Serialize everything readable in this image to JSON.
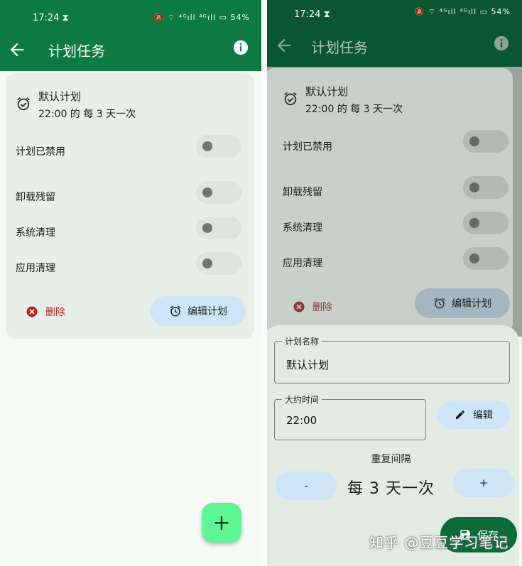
{
  "left": {
    "status": {
      "time": "17:24 ⧗",
      "icons": "🔕 ⌔ ⁴ᴳıll ⁴ᴳıll ▭ 54%",
      "battery": "54%"
    },
    "appbar": {
      "title": "计划任务"
    },
    "card": {
      "plan_name": "默认计划",
      "schedule": "22:00 的 每 3 天一次",
      "rows": [
        {
          "label": "计划已禁用",
          "enabled": false
        },
        {
          "label": "卸载残留",
          "enabled": false
        },
        {
          "label": "系统清理",
          "enabled": false
        },
        {
          "label": "应用清理",
          "enabled": false
        }
      ],
      "delete_label": "删除",
      "edit_plan_label": "编辑计划"
    },
    "fab_label": "+"
  },
  "right": {
    "status": {
      "time": "17:24 ⧗",
      "icons": "🔕 ⌔ ⁴ᴳıll ⁴ᴳıll ▭ 54%"
    },
    "appbar": {
      "title": "计划任务"
    },
    "card": {
      "plan_name": "默认计划",
      "schedule": "22:00 的 每 3 天一次",
      "rows": [
        {
          "label": "计划已禁用"
        },
        {
          "label": "卸载残留"
        },
        {
          "label": "系统清理"
        },
        {
          "label": "应用清理"
        }
      ],
      "delete_label": "删除",
      "edit_plan_label": "编辑计划"
    },
    "sheet": {
      "name_field": {
        "label": "计划名称",
        "value": "默认计划"
      },
      "time_field": {
        "label": "大约时间",
        "value": "22:00"
      },
      "edit_label": "编辑",
      "interval_label": "重复间隔",
      "minus_label": "-",
      "plus_label": "+",
      "interval_value": "每 3 天一次",
      "save_label": "保存"
    }
  },
  "watermark": "知乎 @豆豆学习笔记",
  "colors": {
    "appbar_green": "#0c7a41",
    "fab_green": "#5ef594",
    "tonal_blue": "#cde5f6",
    "delete_red": "#b3261e",
    "save_green": "#0d6b3a"
  }
}
